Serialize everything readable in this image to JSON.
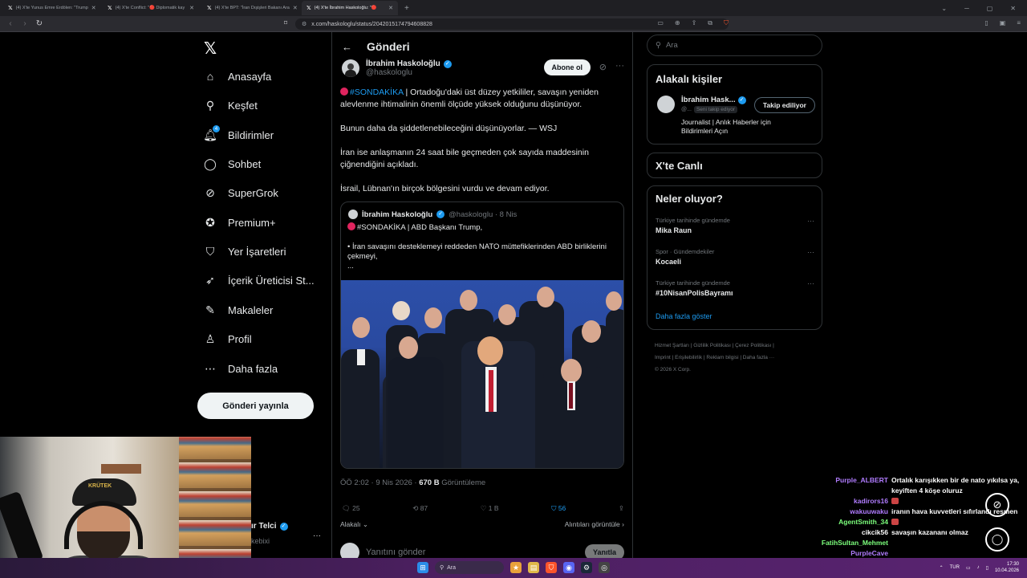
{
  "browser": {
    "tabs": [
      {
        "title": "(4) X'te Yunus Emre Erdölen: \"Trump",
        "active": false
      },
      {
        "title": "(4) X'te Conflict: \"🔴 Diplomatik kay",
        "active": false
      },
      {
        "title": "(4) X'te BPT: \"İran Dışişleri Bakanı Ara",
        "active": false
      },
      {
        "title": "(4) X'te İbrahim Haskoloğlu: \"🔴",
        "active": true
      }
    ],
    "url": "x.com/haskologlu/status/2042015174794608828"
  },
  "nav": {
    "items": [
      {
        "label": "Anasayfa",
        "icon": "home-icon"
      },
      {
        "label": "Keşfet",
        "icon": "search-icon"
      },
      {
        "label": "Bildirimler",
        "icon": "bell-icon",
        "badge": "4"
      },
      {
        "label": "Sohbet",
        "icon": "chat-icon"
      },
      {
        "label": "SuperGrok",
        "icon": "grok-icon"
      },
      {
        "label": "Premium+",
        "icon": "premium-icon"
      },
      {
        "label": "Yer İşaretleri",
        "icon": "bookmark-icon"
      },
      {
        "label": "İçerik Üreticisi St...",
        "icon": "rocket-icon"
      },
      {
        "label": "Makaleler",
        "icon": "article-icon"
      },
      {
        "label": "Profil",
        "icon": "person-icon"
      },
      {
        "label": "Daha fazla",
        "icon": "more-circle-icon"
      }
    ],
    "post_button": "Gönderi yayınla"
  },
  "post": {
    "header": "Gönderi",
    "author_name": "İbrahim Haskoloğlu",
    "author_handle": "@haskologlu",
    "subscribe": "Abone ol",
    "hashtag": "#SONDAKİKA",
    "p1_rest": " | Ortadoğu'daki üst düzey yetkililer, savaşın yeniden alevlenme ihtimalinin önemli ölçüde yüksek olduğunu düşünüyor.",
    "p2": "Bunun daha da şiddetlenebileceğini düşünüyorlar. — WSJ",
    "p3": "İran ise anlaşmanın 24 saat bile geçmeden çok sayıda maddesinin çiğnendiğini açıkladı.",
    "p4": "İsrail, Lübnan'ın birçok bölgesini vurdu ve devam ediyor.",
    "quote": {
      "name": "İbrahim Haskoloğlu",
      "meta": "@haskologlu · 8 Nis",
      "line1": "#SONDAKİKA | ABD Başkanı Trump,",
      "line2": "• İran savaşını desteklemeyi reddeden NATO müttefiklerinden ABD birliklerini çekmeyi,",
      "line3": "..."
    },
    "timestamp": "ÖÖ 2:02 · 9 Nis 2026 · ",
    "views": "670 B",
    "views_label": " Görüntüleme",
    "replies": "25",
    "reposts": "87",
    "likes": "1 B",
    "bookmarks": "56",
    "relevant": "Alakalı",
    "view_quotes": "Alıntıları görüntüle",
    "reply_placeholder": "Yanıtını gönder",
    "reply_button": "Yanıtla"
  },
  "sidebar": {
    "search_placeholder": "Ara",
    "related_title": "Alakalı kişiler",
    "person_name": "İbrahim Hask...",
    "person_handle": "@...",
    "person_follows": "Seni takip ediyor",
    "person_bio": "Journalist | Anlık Haberler için Bildirimleri Açın",
    "follow_button": "Takip ediliyor",
    "live_title": "X'te Canlı",
    "trends_title": "Neler oluyor?",
    "trends": [
      {
        "category": "Türkiye tarihinde gündemde",
        "name": "Mika Raun"
      },
      {
        "category": "Spor · Gündemdekiler",
        "name": "Kocaeli"
      },
      {
        "category": "Türkiye tarihinde gündemde",
        "name": "#10NisanPolisBayramı"
      }
    ],
    "show_more": "Daha fazla göster",
    "footer_line1": "Hizmet Şartları  |  Gizlilik Politikası  |  Çerez Politikası  |",
    "footer_line2": "Imprint  |  Erişilebilirlik  |  Reklam bilgisi  |  Daha fazla ···",
    "footer_line3": "© 2026 X Corp."
  },
  "behind_overlay": {
    "name_fragment": "ır Telci",
    "handle_fragment": "kebixi"
  },
  "webcam": {
    "cap_text": "KRÜTEK"
  },
  "chat": [
    {
      "user": "Purple_ALBERT",
      "color": "#b07cff",
      "text": "Ortalık karışıkken bir de nato yıkılsa ya, keyiften 4 köşe oluruz"
    },
    {
      "user": "kadirors16",
      "color": "#b07cff",
      "text": "",
      "emote": true
    },
    {
      "user": "wakuuwaku",
      "color": "#b07cff",
      "text": "iranın hava kuvvetleri sıfırlandı resmen"
    },
    {
      "user": "AgentSmith_34",
      "color": "#7cff7c",
      "text": "",
      "emote": true
    },
    {
      "user": "cikcik56",
      "color": "#ffffff",
      "text": "savaşın kazananı olmaz"
    },
    {
      "user": "FatihSultan_Mehmet",
      "color": "#7cff7c",
      "text": ""
    },
    {
      "user": "PurpleCave",
      "color": "#b07cff",
      "text": ""
    }
  ],
  "taskbar": {
    "search": "Ara",
    "lang": "TUR",
    "time": "17:30",
    "date": "10.04.2026"
  }
}
